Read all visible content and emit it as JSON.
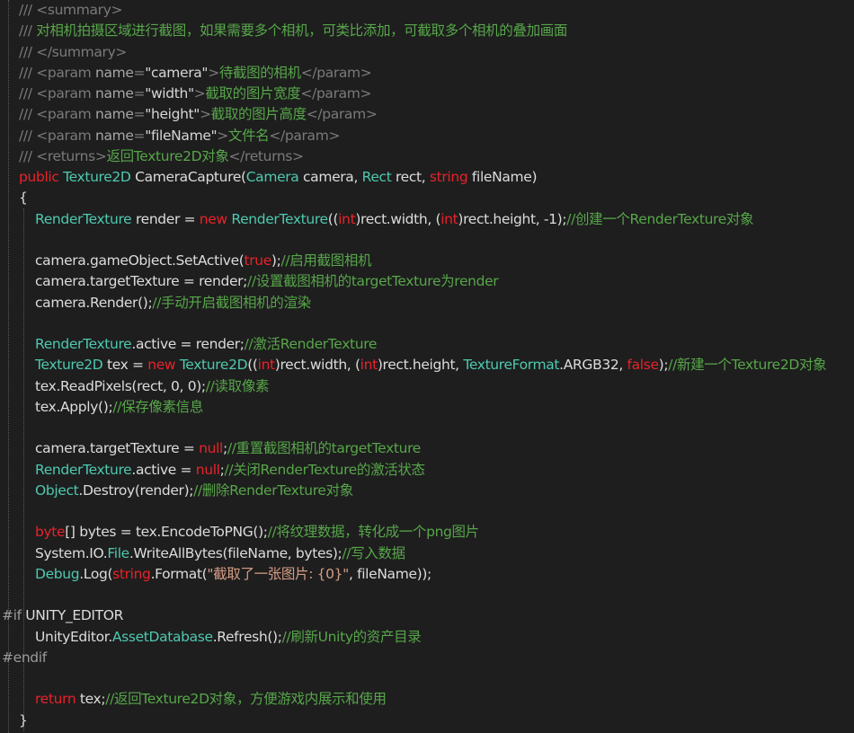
{
  "editor": {
    "colors": {
      "background": "#1e1e1e",
      "plain": "#dcdcdc",
      "keyword": "#e8222a",
      "type": "#4ec9b0",
      "comment": "#57a64a",
      "doc": "#7a7a7a",
      "string": "#d69d85",
      "preprocessor": "#9b9b9b"
    },
    "lines": [
      {
        "indent": 1,
        "tokens": [
          {
            "c": "doc",
            "t": "/// "
          },
          {
            "c": "tag",
            "t": "<summary>"
          }
        ]
      },
      {
        "indent": 1,
        "tokens": [
          {
            "c": "doc",
            "t": "/// "
          },
          {
            "c": "text",
            "t": "对相机拍摄区域进行截图，如果需要多个相机，可类比添加，可截取多个相机的叠加画面"
          }
        ]
      },
      {
        "indent": 1,
        "tokens": [
          {
            "c": "doc",
            "t": "/// "
          },
          {
            "c": "tag",
            "t": "</summary>"
          }
        ]
      },
      {
        "indent": 1,
        "tokens": [
          {
            "c": "doc",
            "t": "/// "
          },
          {
            "c": "tag",
            "t": "<param "
          },
          {
            "c": "attr",
            "t": "name"
          },
          {
            "c": "tag",
            "t": "="
          },
          {
            "c": "attrval",
            "t": "\"camera\""
          },
          {
            "c": "tag",
            "t": ">"
          },
          {
            "c": "text",
            "t": "待截图的相机"
          },
          {
            "c": "tag",
            "t": "</param>"
          }
        ]
      },
      {
        "indent": 1,
        "tokens": [
          {
            "c": "doc",
            "t": "/// "
          },
          {
            "c": "tag",
            "t": "<param "
          },
          {
            "c": "attr",
            "t": "name"
          },
          {
            "c": "tag",
            "t": "="
          },
          {
            "c": "attrval",
            "t": "\"width\""
          },
          {
            "c": "tag",
            "t": ">"
          },
          {
            "c": "text",
            "t": "截取的图片宽度"
          },
          {
            "c": "tag",
            "t": "</param>"
          }
        ]
      },
      {
        "indent": 1,
        "tokens": [
          {
            "c": "doc",
            "t": "/// "
          },
          {
            "c": "tag",
            "t": "<param "
          },
          {
            "c": "attr",
            "t": "name"
          },
          {
            "c": "tag",
            "t": "="
          },
          {
            "c": "attrval",
            "t": "\"height\""
          },
          {
            "c": "tag",
            "t": ">"
          },
          {
            "c": "text",
            "t": "截取的图片高度"
          },
          {
            "c": "tag",
            "t": "</param>"
          }
        ]
      },
      {
        "indent": 1,
        "tokens": [
          {
            "c": "doc",
            "t": "/// "
          },
          {
            "c": "tag",
            "t": "<param "
          },
          {
            "c": "attr",
            "t": "name"
          },
          {
            "c": "tag",
            "t": "="
          },
          {
            "c": "attrval",
            "t": "\"fileName\""
          },
          {
            "c": "tag",
            "t": ">"
          },
          {
            "c": "text",
            "t": "文件名"
          },
          {
            "c": "tag",
            "t": "</param>"
          }
        ]
      },
      {
        "indent": 1,
        "tokens": [
          {
            "c": "doc",
            "t": "/// "
          },
          {
            "c": "tag",
            "t": "<returns>"
          },
          {
            "c": "text",
            "t": "返回Texture2D对象"
          },
          {
            "c": "tag",
            "t": "</returns>"
          }
        ]
      },
      {
        "indent": 1,
        "tokens": [
          {
            "c": "kw",
            "t": "public "
          },
          {
            "c": "type",
            "t": "Texture2D"
          },
          {
            "c": "plain",
            "t": " CameraCapture("
          },
          {
            "c": "type",
            "t": "Camera"
          },
          {
            "c": "plain",
            "t": " camera, "
          },
          {
            "c": "type",
            "t": "Rect"
          },
          {
            "c": "plain",
            "t": " rect, "
          },
          {
            "c": "kw",
            "t": "string"
          },
          {
            "c": "plain",
            "t": " fileName)"
          }
        ]
      },
      {
        "indent": 1,
        "tokens": [
          {
            "c": "plain",
            "t": "{"
          }
        ]
      },
      {
        "indent": 2,
        "tokens": [
          {
            "c": "type",
            "t": "RenderTexture"
          },
          {
            "c": "plain",
            "t": " render = "
          },
          {
            "c": "kw",
            "t": "new "
          },
          {
            "c": "type",
            "t": "RenderTexture"
          },
          {
            "c": "plain",
            "t": "(("
          },
          {
            "c": "kw",
            "t": "int"
          },
          {
            "c": "plain",
            "t": ")rect.width, ("
          },
          {
            "c": "kw",
            "t": "int"
          },
          {
            "c": "plain",
            "t": ")rect.height, -1);"
          },
          {
            "c": "comment",
            "t": "//创建一个RenderTexture对象"
          }
        ]
      },
      {
        "indent": 2,
        "tokens": []
      },
      {
        "indent": 2,
        "tokens": [
          {
            "c": "plain",
            "t": "camera.gameObject.SetActive("
          },
          {
            "c": "kw",
            "t": "true"
          },
          {
            "c": "plain",
            "t": ");"
          },
          {
            "c": "comment",
            "t": "//启用截图相机"
          }
        ]
      },
      {
        "indent": 2,
        "tokens": [
          {
            "c": "plain",
            "t": "camera.targetTexture = render;"
          },
          {
            "c": "comment",
            "t": "//设置截图相机的targetTexture为render"
          }
        ]
      },
      {
        "indent": 2,
        "tokens": [
          {
            "c": "plain",
            "t": "camera.Render();"
          },
          {
            "c": "comment",
            "t": "//手动开启截图相机的渲染"
          }
        ]
      },
      {
        "indent": 2,
        "tokens": []
      },
      {
        "indent": 2,
        "tokens": [
          {
            "c": "type",
            "t": "RenderTexture"
          },
          {
            "c": "plain",
            "t": ".active = render;"
          },
          {
            "c": "comment",
            "t": "//激活RenderTexture"
          }
        ]
      },
      {
        "indent": 2,
        "tokens": [
          {
            "c": "type",
            "t": "Texture2D"
          },
          {
            "c": "plain",
            "t": " tex = "
          },
          {
            "c": "kw",
            "t": "new "
          },
          {
            "c": "type",
            "t": "Texture2D"
          },
          {
            "c": "plain",
            "t": "(("
          },
          {
            "c": "kw",
            "t": "int"
          },
          {
            "c": "plain",
            "t": ")rect.width, ("
          },
          {
            "c": "kw",
            "t": "int"
          },
          {
            "c": "plain",
            "t": ")rect.height, "
          },
          {
            "c": "type",
            "t": "TextureFormat"
          },
          {
            "c": "plain",
            "t": ".ARGB32, "
          },
          {
            "c": "kw",
            "t": "false"
          },
          {
            "c": "plain",
            "t": ");"
          },
          {
            "c": "comment",
            "t": "//新建一个Texture2D对象"
          }
        ]
      },
      {
        "indent": 2,
        "tokens": [
          {
            "c": "plain",
            "t": "tex.ReadPixels(rect, 0, 0);"
          },
          {
            "c": "comment",
            "t": "//读取像素"
          }
        ]
      },
      {
        "indent": 2,
        "tokens": [
          {
            "c": "plain",
            "t": "tex.Apply();"
          },
          {
            "c": "comment",
            "t": "//保存像素信息"
          }
        ]
      },
      {
        "indent": 2,
        "tokens": []
      },
      {
        "indent": 2,
        "tokens": [
          {
            "c": "plain",
            "t": "camera.targetTexture = "
          },
          {
            "c": "kw",
            "t": "null"
          },
          {
            "c": "plain",
            "t": ";"
          },
          {
            "c": "comment",
            "t": "//重置截图相机的targetTexture"
          }
        ]
      },
      {
        "indent": 2,
        "tokens": [
          {
            "c": "type",
            "t": "RenderTexture"
          },
          {
            "c": "plain",
            "t": ".active = "
          },
          {
            "c": "kw",
            "t": "null"
          },
          {
            "c": "plain",
            "t": ";"
          },
          {
            "c": "comment",
            "t": "//关闭RenderTexture的激活状态"
          }
        ]
      },
      {
        "indent": 2,
        "tokens": [
          {
            "c": "type",
            "t": "Object"
          },
          {
            "c": "plain",
            "t": ".Destroy(render);"
          },
          {
            "c": "comment",
            "t": "//删除RenderTexture对象"
          }
        ]
      },
      {
        "indent": 2,
        "tokens": []
      },
      {
        "indent": 2,
        "tokens": [
          {
            "c": "kw",
            "t": "byte"
          },
          {
            "c": "plain",
            "t": "[] bytes = tex.EncodeToPNG();"
          },
          {
            "c": "comment",
            "t": "//将纹理数据，转化成一个png图片"
          }
        ]
      },
      {
        "indent": 2,
        "tokens": [
          {
            "c": "plain",
            "t": "System.IO."
          },
          {
            "c": "type",
            "t": "File"
          },
          {
            "c": "plain",
            "t": ".WriteAllBytes(fileName, bytes);"
          },
          {
            "c": "comment",
            "t": "//写入数据"
          }
        ]
      },
      {
        "indent": 2,
        "tokens": [
          {
            "c": "type",
            "t": "Debug"
          },
          {
            "c": "plain",
            "t": ".Log("
          },
          {
            "c": "kw",
            "t": "string"
          },
          {
            "c": "plain",
            "t": ".Format("
          },
          {
            "c": "str",
            "t": "\"截取了一张图片: {0}\""
          },
          {
            "c": "plain",
            "t": ", fileName));"
          }
        ]
      },
      {
        "indent": 2,
        "tokens": []
      },
      {
        "indent": 0,
        "tokens": [
          {
            "c": "pre",
            "t": "#if "
          },
          {
            "c": "plain",
            "t": "UNITY_EDITOR"
          }
        ]
      },
      {
        "indent": 2,
        "tokens": [
          {
            "c": "plain",
            "t": "UnityEditor."
          },
          {
            "c": "type",
            "t": "AssetDatabase"
          },
          {
            "c": "plain",
            "t": ".Refresh();"
          },
          {
            "c": "comment",
            "t": "//刷新Unity的资产目录"
          }
        ]
      },
      {
        "indent": 0,
        "tokens": [
          {
            "c": "pre",
            "t": "#endif"
          }
        ]
      },
      {
        "indent": 2,
        "tokens": []
      },
      {
        "indent": 2,
        "tokens": [
          {
            "c": "kw",
            "t": "return "
          },
          {
            "c": "plain",
            "t": "tex;"
          },
          {
            "c": "comment",
            "t": "//返回Texture2D对象，方便游戏内展示和使用"
          }
        ]
      },
      {
        "indent": 1,
        "tokens": [
          {
            "c": "plain",
            "t": "}"
          }
        ]
      }
    ]
  }
}
